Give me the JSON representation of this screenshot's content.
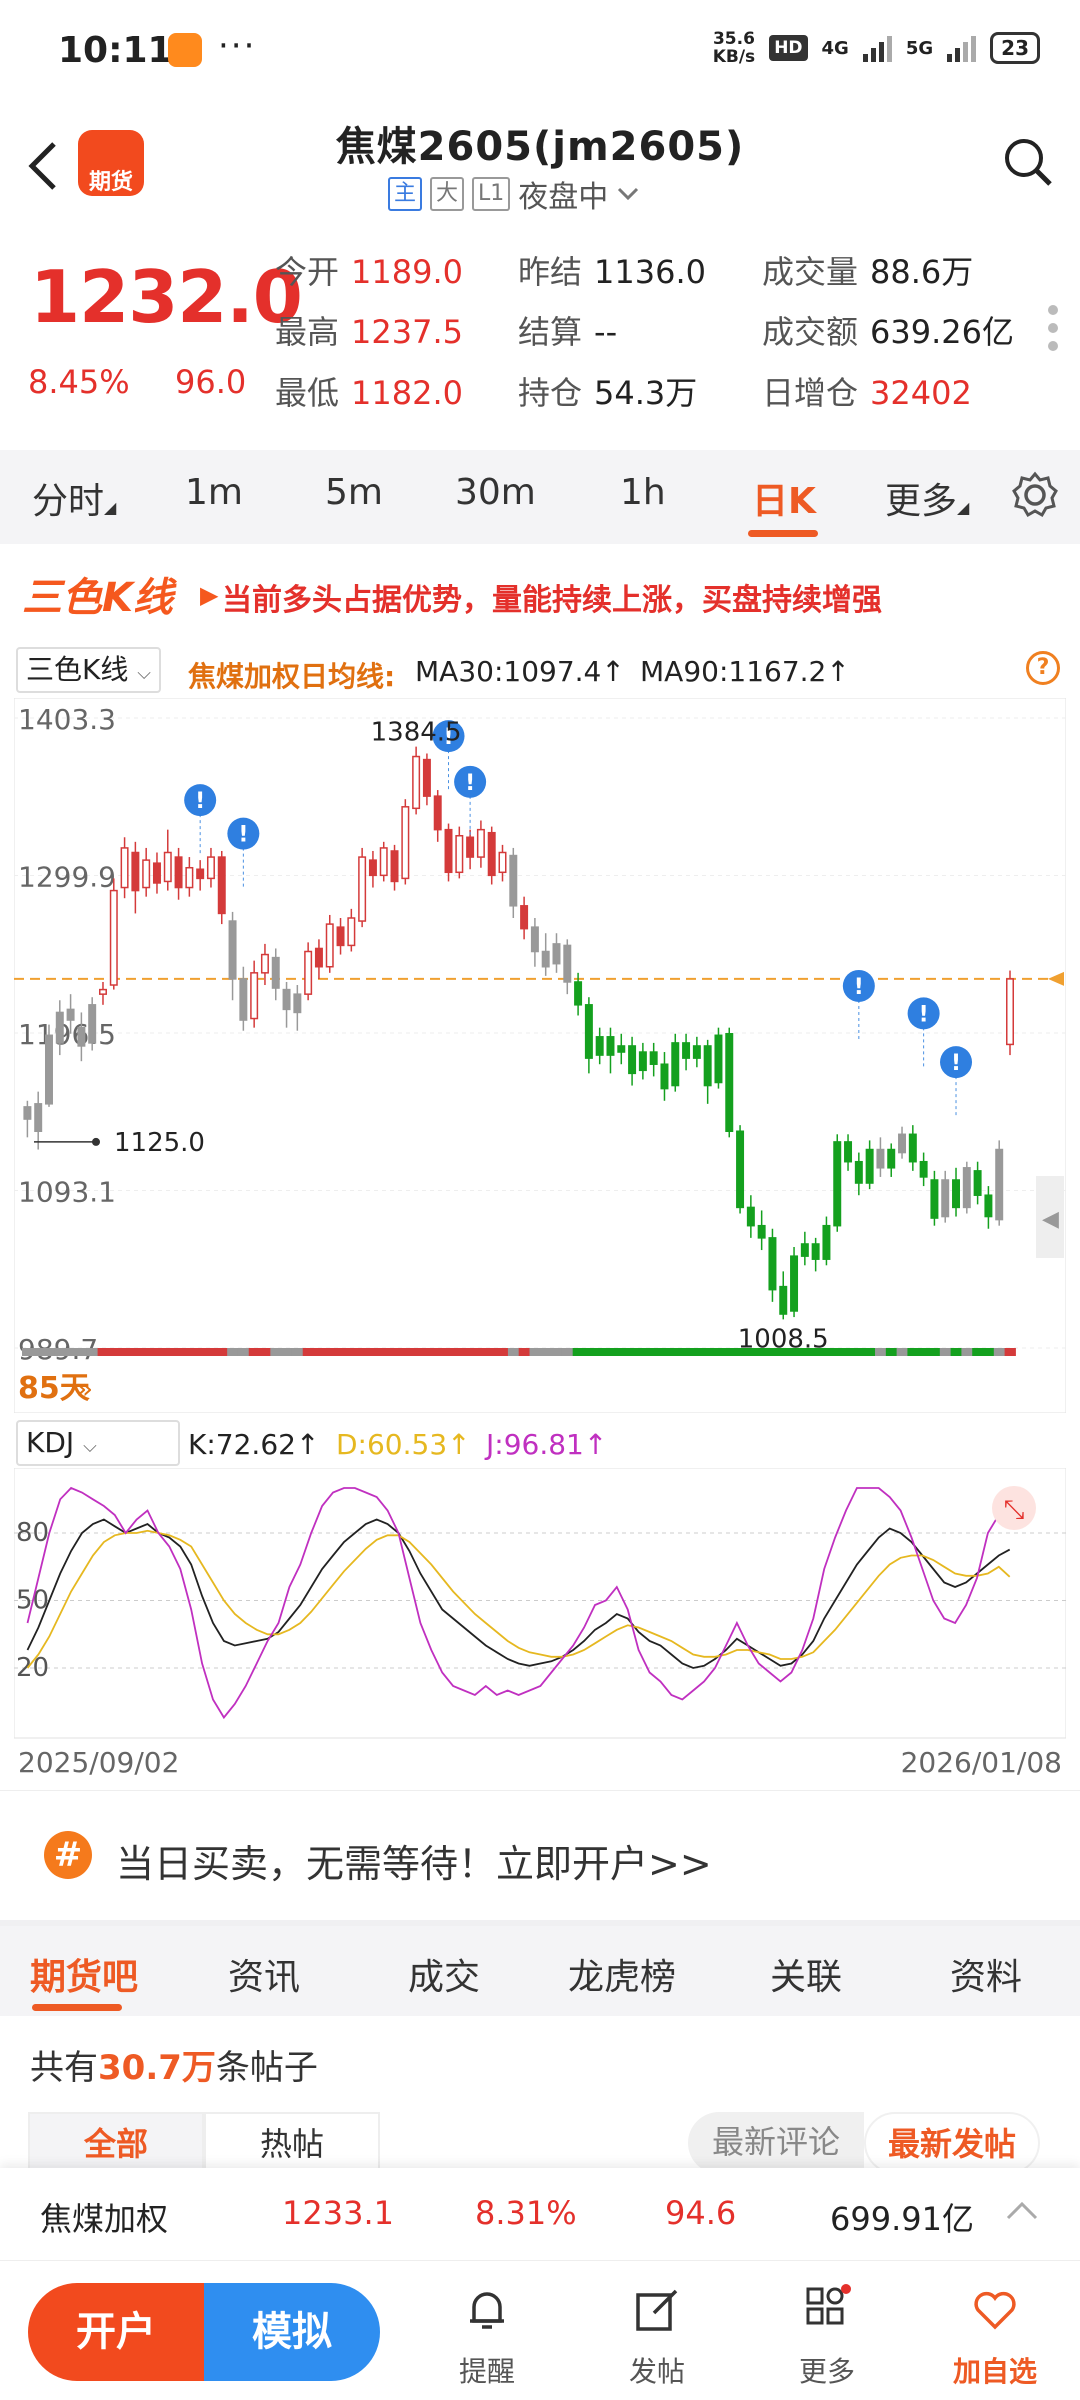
{
  "status": {
    "time": "10:11",
    "dots": "···",
    "speed_top": "35.6",
    "speed_bottom": "KB/s",
    "hd": "HD",
    "net1": "4G",
    "net2": "5G",
    "battery": "23"
  },
  "header": {
    "title": "焦煤2605(jm2605)",
    "logo": "期货",
    "tags": [
      "主",
      "大",
      "L1"
    ],
    "session": "夜盘中"
  },
  "quote": {
    "price": "1232.0",
    "change_pct": "8.45%",
    "change": "96.0",
    "fields": [
      {
        "label": "今开",
        "value": "1189.0",
        "red": true
      },
      {
        "label": "昨结",
        "value": "1136.0",
        "red": false
      },
      {
        "label": "成交量",
        "value": "88.6万",
        "red": false
      },
      {
        "label": "最高",
        "value": "1237.5",
        "red": true
      },
      {
        "label": "结算",
        "value": "--",
        "red": false
      },
      {
        "label": "成交额",
        "value": "639.26亿",
        "red": false
      },
      {
        "label": "最低",
        "value": "1182.0",
        "red": true
      },
      {
        "label": "持仓",
        "value": "54.3万",
        "red": false
      },
      {
        "label": "日增仓",
        "value": "32402",
        "red": true
      }
    ]
  },
  "period_tabs": [
    "分时",
    "1m",
    "5m",
    "30m",
    "1h",
    "日K",
    "更多"
  ],
  "active_period": "日K",
  "banner": {
    "logo": "三色K线",
    "text": "当前多头占据优势，量能持续上涨，买盘持续增强"
  },
  "chart_header": {
    "selector": "三色K线",
    "label": "焦煤加权日均线:",
    "ma30": "MA30:1097.4",
    "ma90": "MA90:1167.2",
    "arrow": "↑",
    "help": "?"
  },
  "kdj_header": {
    "selector": "KDJ",
    "k": "K:72.62",
    "d": "D:60.53",
    "j": "J:96.81"
  },
  "chart_data": [
    {
      "type": "candlestick",
      "yticks": [
        "1403.3",
        "1299.9",
        "1196.5",
        "1093.1",
        "989.7"
      ],
      "ylim": [
        989.7,
        1403.3
      ],
      "high_label": "1384.5",
      "low_labels": [
        "1125.0",
        "1008.5"
      ],
      "reference_line": 1232.0,
      "days_label": "85天",
      "x_start": "2025/09/02",
      "x_end": "2026/01/08",
      "candles": [
        [
          1140,
          1148,
          1128,
          1152,
          "gray"
        ],
        [
          1132,
          1150,
          1120,
          1158,
          "gray"
        ],
        [
          1150,
          1195,
          1148,
          1202,
          "gray"
        ],
        [
          1190,
          1210,
          1182,
          1218,
          "gray"
        ],
        [
          1205,
          1212,
          1196,
          1222,
          "gray"
        ],
        [
          1200,
          1188,
          1178,
          1210,
          "gray"
        ],
        [
          1190,
          1215,
          1185,
          1220,
          "gray"
        ],
        [
          1222,
          1225,
          1215,
          1230,
          "red"
        ],
        [
          1228,
          1290,
          1225,
          1298,
          "red"
        ],
        [
          1292,
          1318,
          1285,
          1325,
          "red"
        ],
        [
          1315,
          1290,
          1275,
          1322,
          "red"
        ],
        [
          1292,
          1310,
          1286,
          1318,
          "red"
        ],
        [
          1308,
          1295,
          1288,
          1315,
          "red"
        ],
        [
          1296,
          1315,
          1290,
          1330,
          "red"
        ],
        [
          1312,
          1292,
          1284,
          1318,
          "red"
        ],
        [
          1292,
          1305,
          1286,
          1312,
          "red"
        ],
        [
          1304,
          1298,
          1290,
          1310,
          "red"
        ],
        [
          1298,
          1312,
          1292,
          1318,
          "red"
        ],
        [
          1312,
          1275,
          1268,
          1316,
          "red"
        ],
        [
          1270,
          1232,
          1218,
          1276,
          "gray"
        ],
        [
          1232,
          1205,
          1198,
          1240,
          "gray"
        ],
        [
          1206,
          1236,
          1200,
          1244,
          "red"
        ],
        [
          1236,
          1248,
          1228,
          1255,
          "red"
        ],
        [
          1246,
          1226,
          1218,
          1252,
          "gray"
        ],
        [
          1225,
          1212,
          1200,
          1230,
          "gray"
        ],
        [
          1210,
          1222,
          1198,
          1228,
          "gray"
        ],
        [
          1222,
          1250,
          1218,
          1256,
          "red"
        ],
        [
          1252,
          1240,
          1232,
          1258,
          "red"
        ],
        [
          1240,
          1268,
          1236,
          1274,
          "red"
        ],
        [
          1266,
          1254,
          1248,
          1272,
          "red"
        ],
        [
          1254,
          1272,
          1250,
          1278,
          "red"
        ],
        [
          1270,
          1312,
          1266,
          1318,
          "red"
        ],
        [
          1310,
          1300,
          1292,
          1316,
          "red"
        ],
        [
          1300,
          1318,
          1296,
          1322,
          "red"
        ],
        [
          1316,
          1296,
          1290,
          1320,
          "red"
        ],
        [
          1298,
          1345,
          1294,
          1350,
          "red"
        ],
        [
          1344,
          1378,
          1340,
          1384.5,
          "red"
        ],
        [
          1376,
          1352,
          1346,
          1380,
          "red"
        ],
        [
          1352,
          1330,
          1322,
          1356,
          "red"
        ],
        [
          1330,
          1302,
          1296,
          1334,
          "red"
        ],
        [
          1302,
          1326,
          1298,
          1332,
          "red"
        ],
        [
          1325,
          1312,
          1304,
          1330,
          "red"
        ],
        [
          1312,
          1330,
          1305,
          1336,
          "red"
        ],
        [
          1328,
          1300,
          1294,
          1332,
          "red"
        ],
        [
          1302,
          1315,
          1296,
          1320,
          "red"
        ],
        [
          1313,
          1280,
          1272,
          1318,
          "gray"
        ],
        [
          1280,
          1265,
          1258,
          1286,
          "red"
        ],
        [
          1266,
          1250,
          1240,
          1272,
          "gray"
        ],
        [
          1250,
          1240,
          1234,
          1262,
          "gray"
        ],
        [
          1242,
          1255,
          1236,
          1262,
          "gray"
        ],
        [
          1254,
          1230,
          1222,
          1258,
          "gray"
        ],
        [
          1230,
          1215,
          1208,
          1236,
          "green"
        ],
        [
          1215,
          1180,
          1170,
          1220,
          "green"
        ],
        [
          1182,
          1194,
          1176,
          1200,
          "green"
        ],
        [
          1194,
          1182,
          1170,
          1200,
          "green"
        ],
        [
          1184,
          1188,
          1176,
          1196,
          "green"
        ],
        [
          1188,
          1170,
          1162,
          1194,
          "green"
        ],
        [
          1172,
          1184,
          1166,
          1190,
          "green"
        ],
        [
          1184,
          1176,
          1168,
          1190,
          "green"
        ],
        [
          1176,
          1160,
          1152,
          1184,
          "green"
        ],
        [
          1162,
          1190,
          1158,
          1196,
          "green"
        ],
        [
          1190,
          1180,
          1172,
          1196,
          "green"
        ],
        [
          1180,
          1188,
          1174,
          1194,
          "green"
        ],
        [
          1188,
          1162,
          1150,
          1192,
          "green"
        ],
        [
          1164,
          1195,
          1160,
          1200,
          "green"
        ],
        [
          1196,
          1132,
          1128,
          1200,
          "green"
        ],
        [
          1132,
          1082,
          1078,
          1136,
          "green"
        ],
        [
          1082,
          1070,
          1062,
          1090,
          "green"
        ],
        [
          1070,
          1062,
          1054,
          1080,
          "green"
        ],
        [
          1062,
          1028,
          1020,
          1068,
          "green"
        ],
        [
          1030,
          1012,
          1008.5,
          1040,
          "green"
        ],
        [
          1014,
          1050,
          1010,
          1056,
          "green"
        ],
        [
          1050,
          1058,
          1044,
          1066,
          "green"
        ],
        [
          1058,
          1048,
          1040,
          1062,
          "green"
        ],
        [
          1048,
          1070,
          1044,
          1076,
          "green"
        ],
        [
          1070,
          1125,
          1066,
          1130,
          "green"
        ],
        [
          1125,
          1112,
          1106,
          1130,
          "green"
        ],
        [
          1112,
          1098,
          1090,
          1118,
          "green"
        ],
        [
          1098,
          1120,
          1094,
          1126,
          "green"
        ],
        [
          1120,
          1108,
          1102,
          1128,
          "gray"
        ],
        [
          1108,
          1120,
          1102,
          1124,
          "green"
        ],
        [
          1118,
          1130,
          1114,
          1135,
          "gray"
        ],
        [
          1130,
          1112,
          1106,
          1136,
          "green"
        ],
        [
          1112,
          1102,
          1096,
          1118,
          "green"
        ],
        [
          1100,
          1075,
          1070,
          1106,
          "green"
        ],
        [
          1076,
          1100,
          1072,
          1106,
          "gray"
        ],
        [
          1100,
          1082,
          1076,
          1108,
          "green"
        ],
        [
          1082,
          1108,
          1078,
          1112,
          "gray"
        ],
        [
          1106,
          1090,
          1084,
          1112,
          "green"
        ],
        [
          1090,
          1076,
          1068,
          1096,
          "green"
        ],
        [
          1074,
          1120,
          1070,
          1126,
          "gray"
        ],
        [
          1189,
          1232,
          1182,
          1237.5,
          "red"
        ]
      ],
      "alerts": [
        [
          16,
          1310
        ],
        [
          20,
          1288
        ],
        [
          39,
          1352
        ],
        [
          41,
          1322
        ],
        [
          77,
          1188
        ],
        [
          83,
          1170
        ],
        [
          86,
          1138
        ]
      ]
    },
    {
      "type": "line",
      "name": "KDJ",
      "yticks": [
        "80",
        "50",
        "20"
      ],
      "ylim": [
        0,
        100
      ],
      "series": [
        {
          "name": "K",
          "color": "#222222",
          "values": [
            28,
            38,
            50,
            62,
            72,
            80,
            84,
            86,
            83,
            80,
            82,
            84,
            80,
            78,
            74,
            66,
            52,
            40,
            32,
            30,
            31,
            32,
            33,
            36,
            42,
            48,
            56,
            64,
            70,
            76,
            80,
            84,
            86,
            84,
            80,
            72,
            62,
            54,
            46,
            42,
            38,
            34,
            30,
            27,
            24,
            22,
            21,
            22,
            23,
            25,
            28,
            32,
            37,
            40,
            44,
            42,
            36,
            32,
            30,
            26,
            22,
            20,
            21,
            24,
            28,
            33,
            30,
            27,
            24,
            21,
            22,
            26,
            32,
            42,
            50,
            58,
            66,
            72,
            78,
            82,
            80,
            76,
            70,
            64,
            58,
            56,
            58,
            62,
            66,
            70,
            72.62
          ]
        },
        {
          "name": "D",
          "color": "#e6b820",
          "values": [
            20,
            26,
            34,
            44,
            54,
            62,
            70,
            76,
            79,
            80,
            80,
            81,
            80,
            79,
            77,
            74,
            66,
            58,
            50,
            44,
            40,
            37,
            35,
            35,
            37,
            40,
            45,
            51,
            57,
            63,
            68,
            73,
            77,
            79,
            79,
            76,
            71,
            66,
            60,
            54,
            49,
            44,
            40,
            36,
            32,
            29,
            27,
            26,
            25,
            25,
            26,
            28,
            31,
            34,
            37,
            39,
            38,
            36,
            34,
            32,
            29,
            26,
            25,
            25,
            26,
            28,
            28,
            27,
            26,
            24,
            24,
            25,
            27,
            32,
            37,
            43,
            49,
            55,
            61,
            66,
            69,
            70,
            70,
            68,
            65,
            62,
            61,
            61,
            62,
            65,
            60.53
          ]
        },
        {
          "name": "J",
          "color": "#c030c0",
          "values": [
            40,
            60,
            80,
            95,
            100,
            98,
            95,
            92,
            88,
            80,
            86,
            90,
            80,
            74,
            64,
            46,
            22,
            6,
            -2,
            4,
            12,
            22,
            32,
            40,
            56,
            66,
            80,
            92,
            98,
            100,
            100,
            98,
            96,
            90,
            80,
            60,
            40,
            28,
            18,
            12,
            10,
            8,
            12,
            8,
            10,
            8,
            10,
            12,
            18,
            24,
            30,
            38,
            48,
            50,
            56,
            46,
            28,
            18,
            14,
            8,
            6,
            10,
            14,
            20,
            30,
            40,
            30,
            22,
            18,
            14,
            18,
            28,
            42,
            64,
            78,
            90,
            100,
            100,
            100,
            96,
            90,
            78,
            64,
            50,
            42,
            40,
            48,
            60,
            80,
            88,
            96.81
          ]
        }
      ],
      "x_start": "2025/09/02",
      "x_end": "2026/01/08"
    }
  ],
  "promo": {
    "hash": "#",
    "text": "当日买卖，无需等待！立即开户>>"
  },
  "community_tabs": [
    "期货吧",
    "资讯",
    "成交",
    "龙虎榜",
    "关联",
    "资料"
  ],
  "post_count": {
    "prefix": "共有",
    "value": "30.7万",
    "suffix": "条帖子"
  },
  "post_filters": [
    "全部",
    "热帖"
  ],
  "post_sort": [
    "最新评论",
    "最新发帖"
  ],
  "sticky": {
    "name": "焦煤加权",
    "price": "1233.1",
    "pct": "8.31%",
    "chg": "94.6",
    "amount": "699.91亿"
  },
  "bottom_nav": {
    "open": "开户",
    "sim": "模拟",
    "items": [
      "提醒",
      "发帖",
      "更多",
      "加自选"
    ]
  }
}
